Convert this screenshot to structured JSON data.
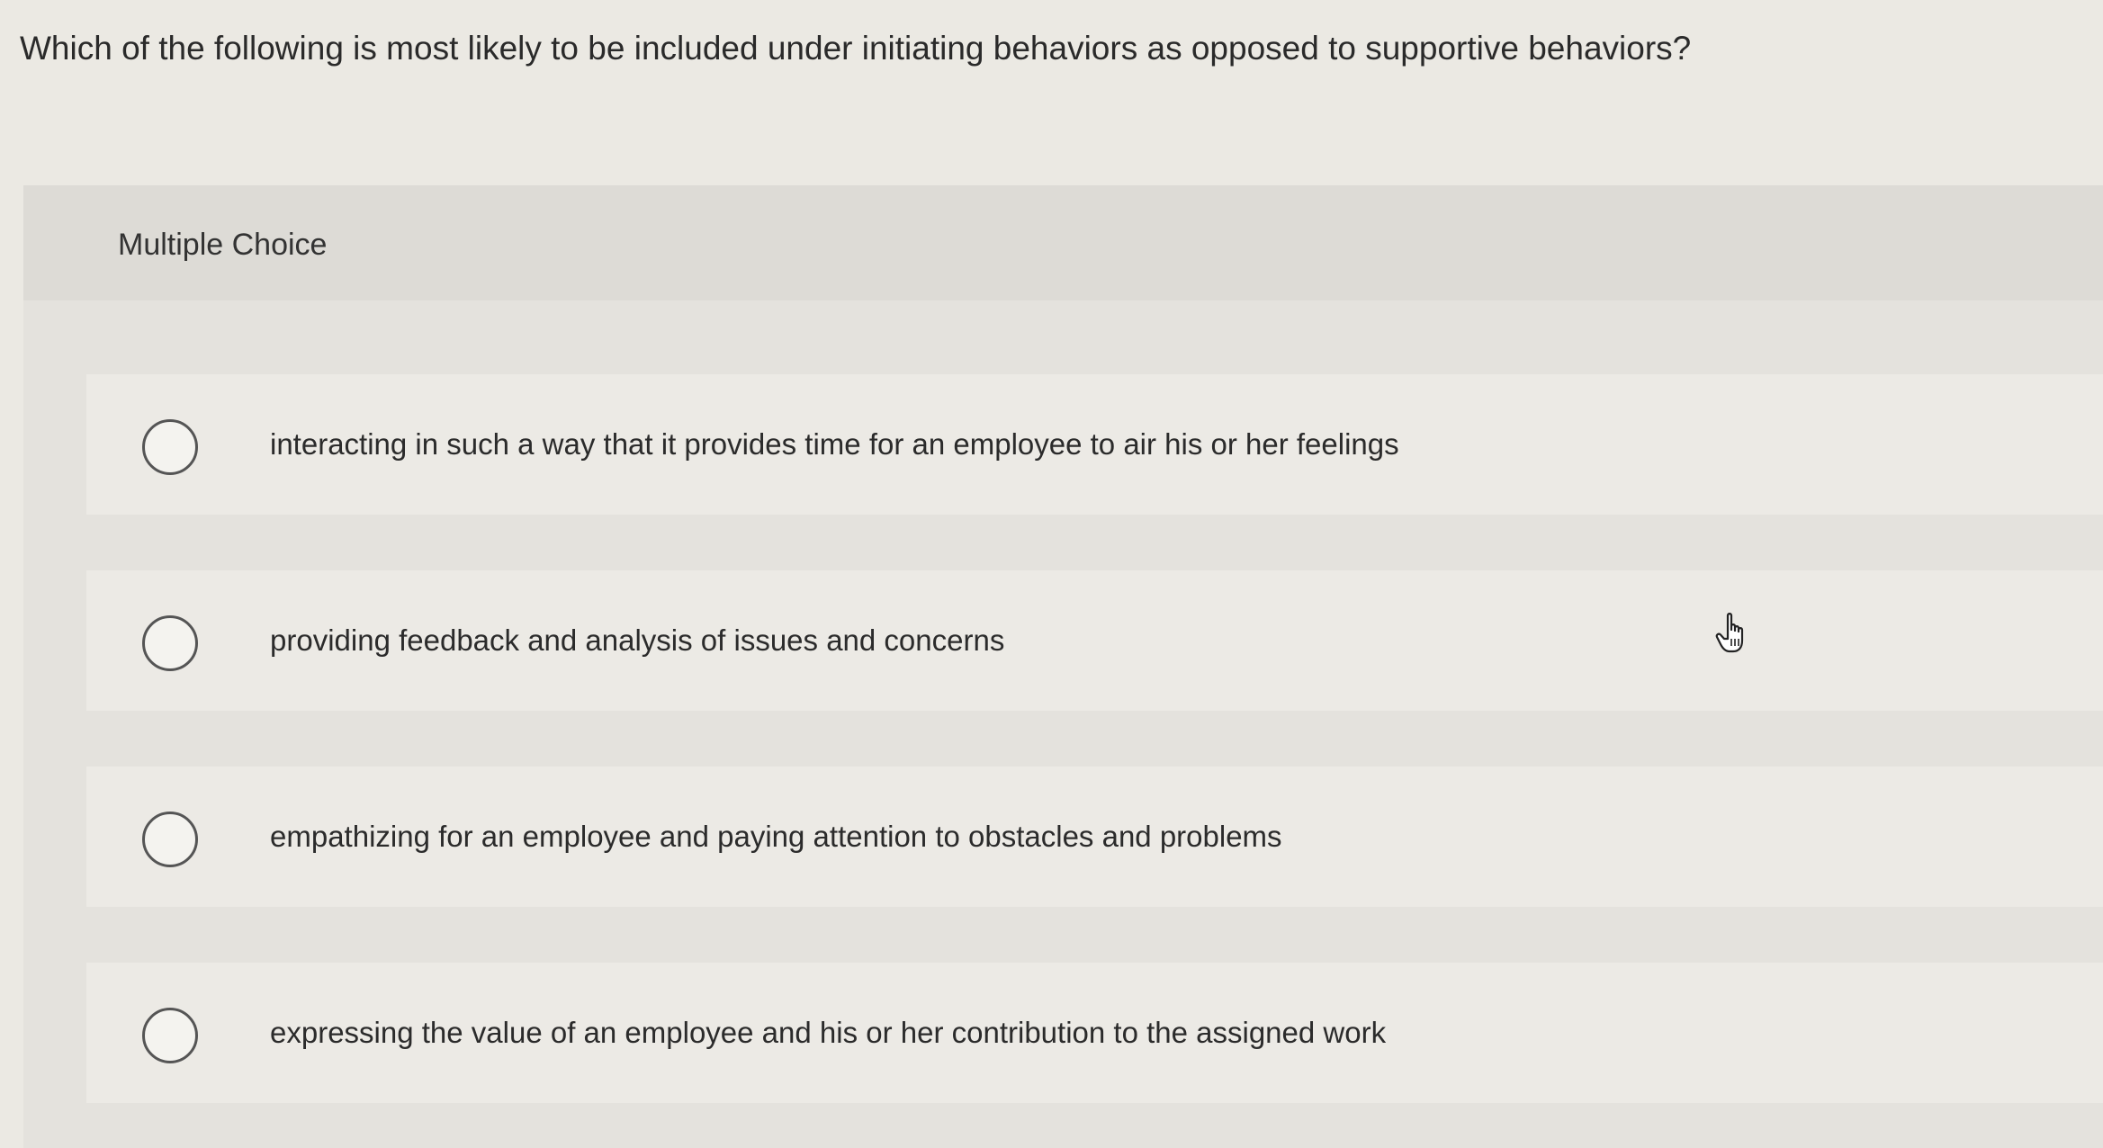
{
  "question": {
    "text": "Which of the following is most likely to be included under initiating behaviors as opposed to supportive behaviors?"
  },
  "panel": {
    "label": "Multiple Choice"
  },
  "options": [
    {
      "text": "interacting in such a way that it provides time for an employee to air his or her feelings",
      "selected": false
    },
    {
      "text": "providing feedback and analysis of issues and concerns",
      "selected": false
    },
    {
      "text": "empathizing for an employee and paying attention to obstacles and problems",
      "selected": false
    },
    {
      "text": "expressing the value of an employee and his or her contribution to the assigned work",
      "selected": false
    }
  ],
  "cursor": {
    "icon": "hand-pointer-icon"
  }
}
